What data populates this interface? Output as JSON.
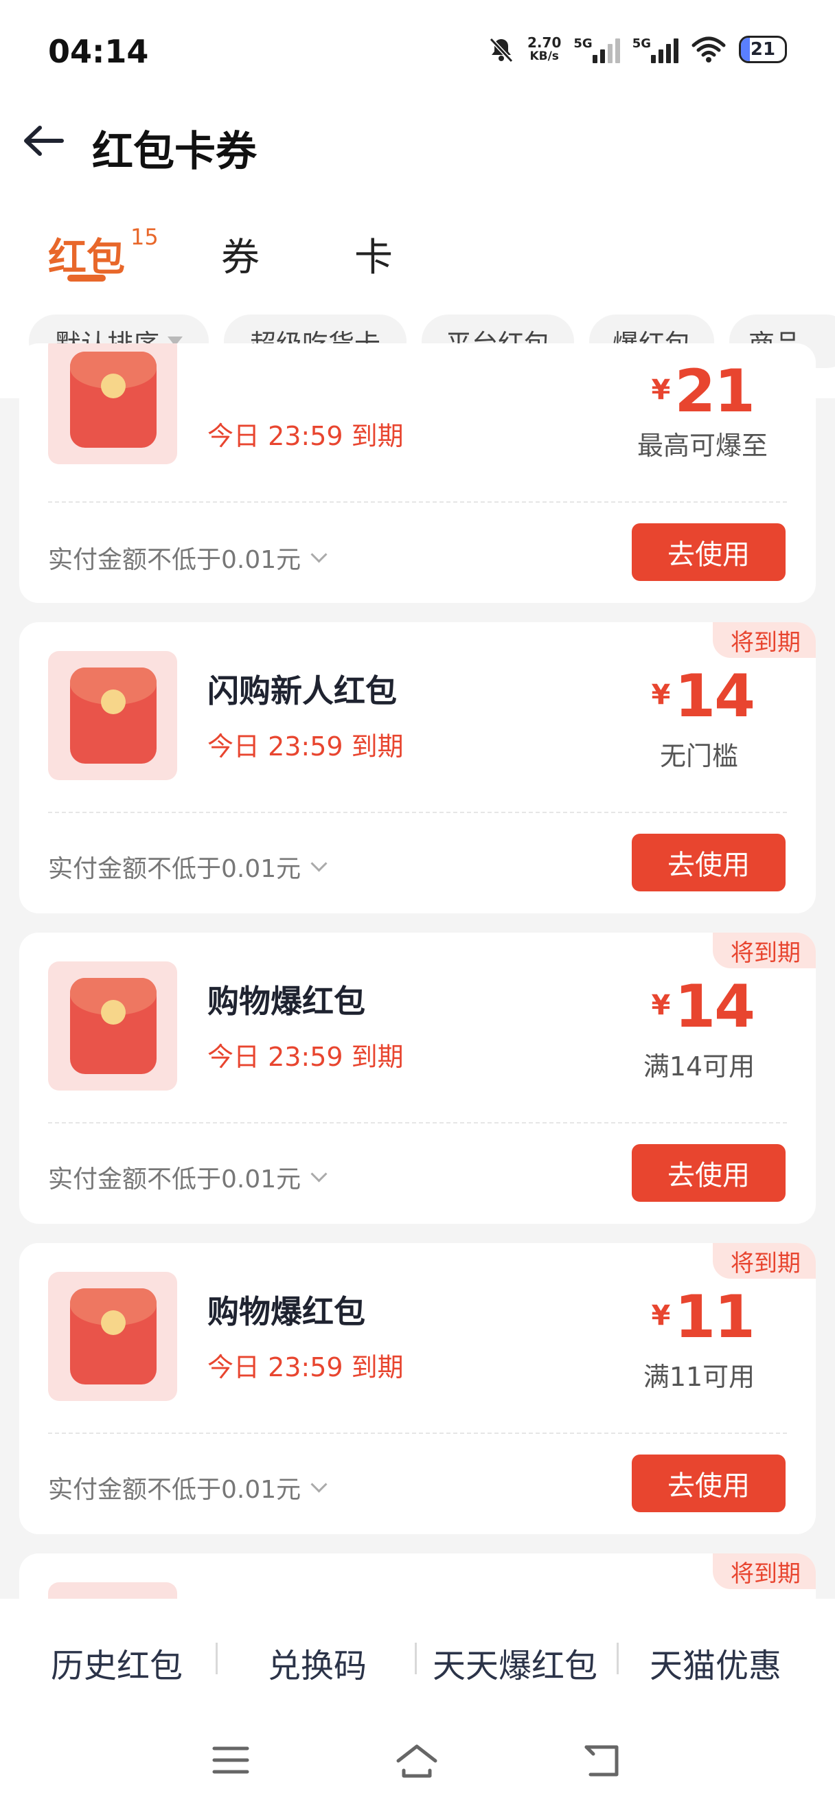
{
  "status_bar": {
    "time": "04:14",
    "net_speed_top": "2.70",
    "net_speed_bottom": "KB/s",
    "sig1": "5G",
    "sig2": "5G",
    "battery": "21"
  },
  "header": {
    "title": "红包卡券"
  },
  "tabs": [
    {
      "label": "红包",
      "badge": "15"
    },
    {
      "label": "券"
    },
    {
      "label": "卡"
    }
  ],
  "filters": [
    "默认排序",
    "超级吃货卡",
    "平台红包",
    "爆红包",
    "商品"
  ],
  "cards": [
    {
      "name": "",
      "expiry": "今日 23:59 到期",
      "currency": "¥",
      "amount": "21",
      "condition": "最高可爆至",
      "note": "实付金额不低于0.01元",
      "button": "去使用",
      "tag": ""
    },
    {
      "name": "闪购新人红包",
      "expiry": "今日 23:59 到期",
      "currency": "¥",
      "amount": "14",
      "condition": "无门槛",
      "note": "实付金额不低于0.01元",
      "button": "去使用",
      "tag": "将到期"
    },
    {
      "name": "购物爆红包",
      "expiry": "今日 23:59 到期",
      "currency": "¥",
      "amount": "14",
      "condition": "满14可用",
      "note": "实付金额不低于0.01元",
      "button": "去使用",
      "tag": "将到期"
    },
    {
      "name": "购物爆红包",
      "expiry": "今日 23:59 到期",
      "currency": "¥",
      "amount": "11",
      "condition": "满11可用",
      "note": "实付金额不低于0.01元",
      "button": "去使用",
      "tag": "将到期"
    },
    {
      "tag": "将到期"
    }
  ],
  "bottom_links": [
    "历史红包",
    "兑换码",
    "天天爆红包",
    "天猫优惠"
  ],
  "colors": {
    "accent_orange": "#e8672a",
    "primary_red": "#e8452f",
    "tag_bg": "#fde4e0"
  }
}
